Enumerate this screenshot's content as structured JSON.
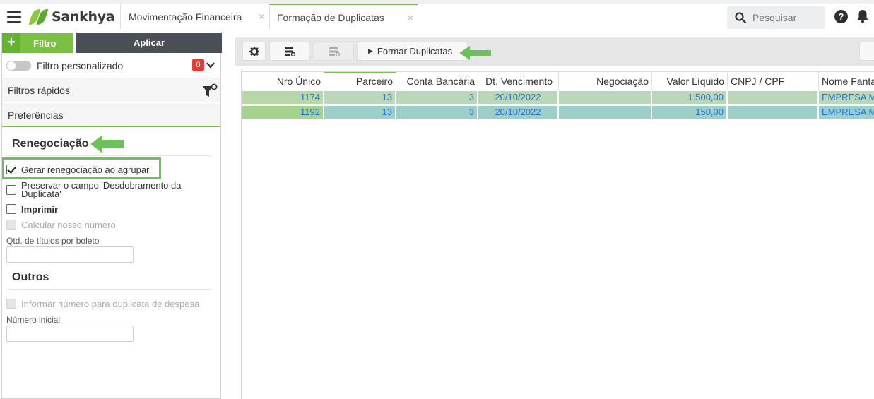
{
  "app": {
    "logo_text": "Sankhya",
    "brand_color": "#7ac143",
    "tabs": [
      {
        "label": "Movimentação Financeira",
        "close": "×"
      },
      {
        "label": "Formação de Duplicatas",
        "close": "×",
        "active": true
      }
    ],
    "search_placeholder": "Pesquisar",
    "help_icon": "?"
  },
  "filter_panel": {
    "filtro_label": "Filtro",
    "plus": "+",
    "aplicar_label": "Aplicar",
    "filtro_personalizado": "Filtro personalizado",
    "filtro_personalizado_on": false,
    "badge_count": "0",
    "filtros_rapidos": "Filtros rápidos",
    "preferencias": "Preferências",
    "renegociacao_heading": "Renegociação",
    "options": [
      {
        "label": "Gerar renegociação ao agrupar",
        "checked": true,
        "disabled": false
      },
      {
        "label": "Preservar o campo 'Desdobramento da Duplicata'",
        "checked": false,
        "disabled": false
      },
      {
        "label": "Imprimir",
        "checked": false,
        "disabled": false
      },
      {
        "label": "Calcular nosso número",
        "checked": false,
        "disabled": true
      }
    ],
    "qtd_titulos_label": "Qtd. de títulos por boleto",
    "qtd_titulos_value": "",
    "outros_heading": "Outros",
    "informar_numero_label": "Informar número para duplicata de despesa",
    "informar_numero_disabled": true,
    "numero_inicial_label": "Número inicial",
    "numero_inicial_value": ""
  },
  "toolbar": {
    "formar_duplicatas": "Formar Duplicatas",
    "play_glyph": "▶"
  },
  "grid": {
    "columns": [
      "Nro Único",
      "Parceiro",
      "Conta Bancária",
      "Dt. Vencimento",
      "Negociação",
      "Valor Líquido",
      "CNPJ / CPF",
      "Nome Fanta"
    ],
    "rows": [
      [
        "1174",
        "13",
        "3",
        "20/10/2022",
        "",
        "1.500,00",
        "",
        "EMPRESA M"
      ],
      [
        "1192",
        "13",
        "3",
        "20/10/2022",
        "",
        "150,00",
        "",
        "EMPRESA M"
      ]
    ]
  }
}
